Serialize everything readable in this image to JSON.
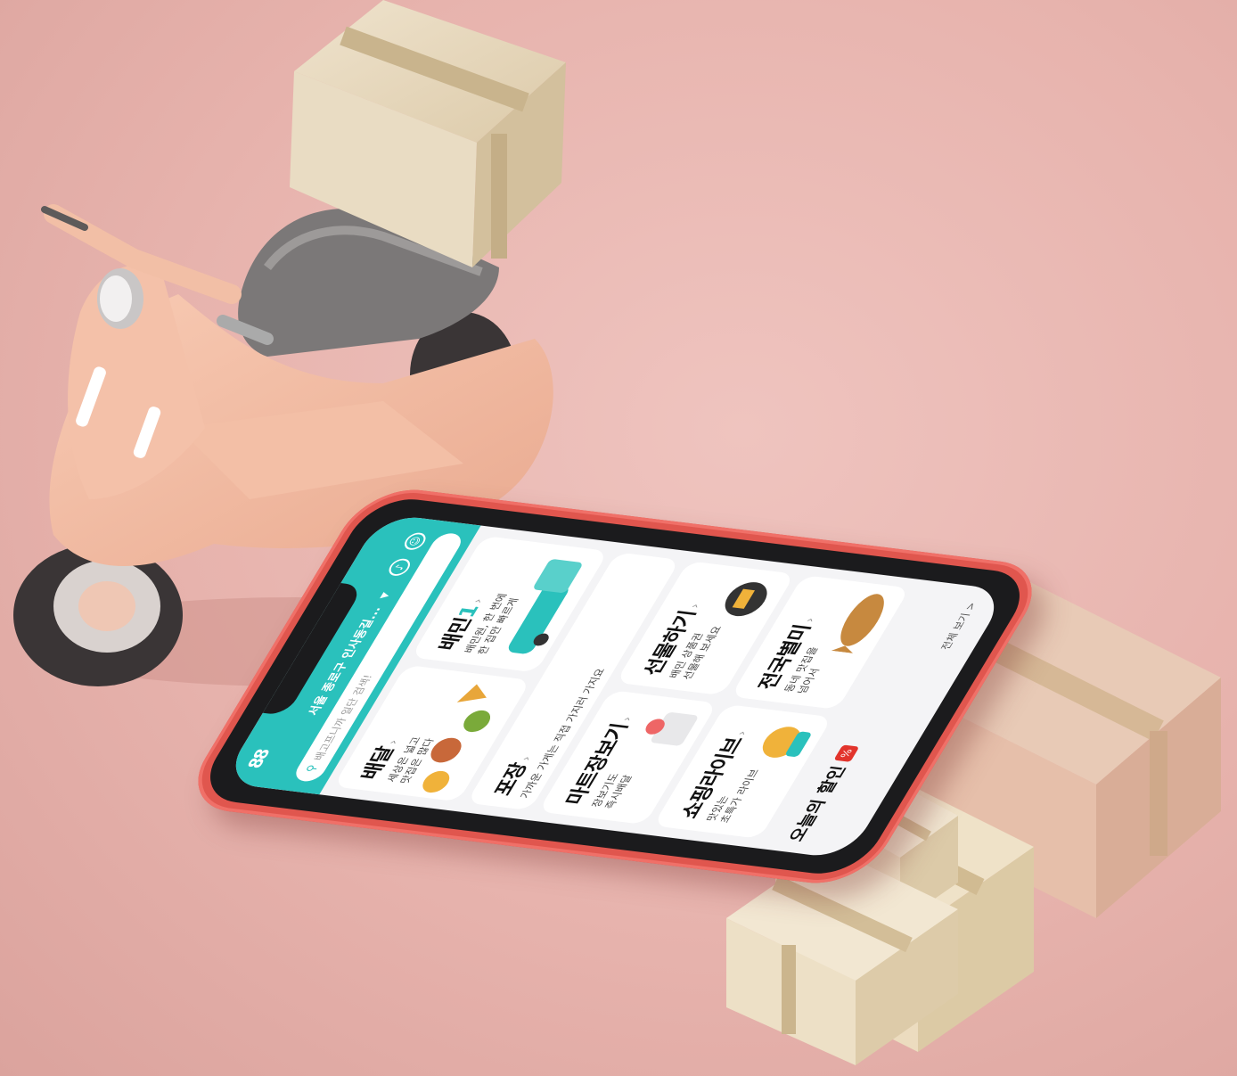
{
  "app": {
    "logo": "88",
    "address": "서울 종로구 인사동길...",
    "search_placeholder": "배고프니까 일단 검색!",
    "brand_color": "#2ac1bc"
  },
  "header_icons": [
    "bell-icon",
    "profile-icon"
  ],
  "cards": {
    "delivery": {
      "title": "배달",
      "sub": "세상은 넓고\n맛집은 많다"
    },
    "baemin1": {
      "title": "배민",
      "title_suffix": "1",
      "sub": "배민원, 한 번에\n한 집만 빠르게"
    },
    "takeout": {
      "title": "포장",
      "sub": "가까운 가게는 직접 가지러 가지요"
    },
    "mart": {
      "title": "마트장보기",
      "sub": "장보기도\n즉시배달"
    },
    "gift": {
      "title": "선물하기",
      "sub": "배민 상품권\n선물해 보세요"
    },
    "live": {
      "title": "쇼핑라이브",
      "sub": "맛있는\n초특가 라이브"
    },
    "national": {
      "title": "전국별미",
      "sub": "동네 맛집을\n넘어서"
    }
  },
  "deals": {
    "title": "오늘의 할인",
    "see_all": "전체 보기 >"
  }
}
